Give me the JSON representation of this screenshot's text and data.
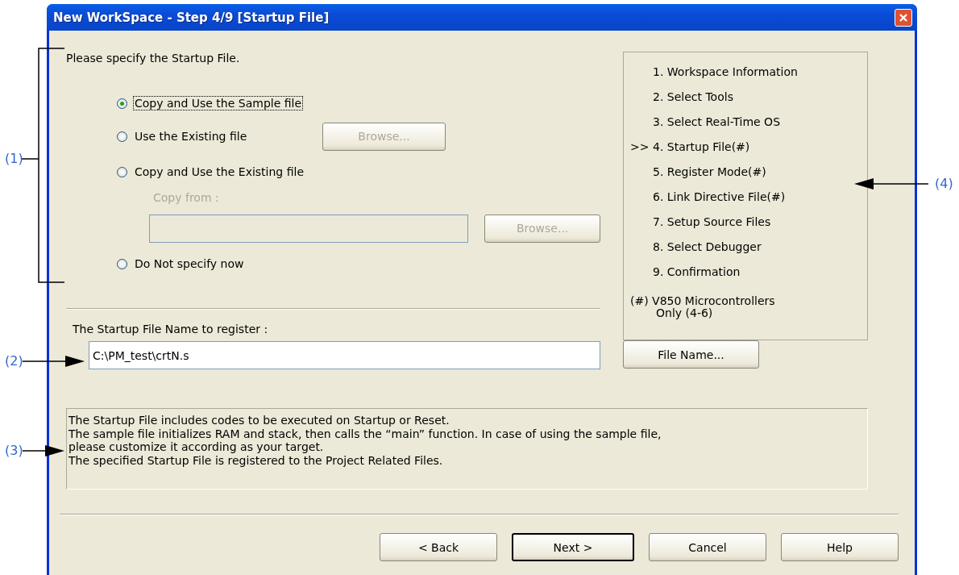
{
  "window": {
    "title": "New WorkSpace - Step 4/9 [Startup File]"
  },
  "prompt": "Please specify the Startup File.",
  "options": [
    {
      "label": "Copy and Use the Sample file",
      "selected": true,
      "focused": true
    },
    {
      "label": "Use the Existing file",
      "selected": false,
      "focused": false,
      "browse": {
        "label": "Browse...",
        "disabled": true
      }
    },
    {
      "label": "Copy and Use the Existing file",
      "selected": false,
      "focused": false,
      "copy_from": {
        "label": "Copy from :",
        "disabled": true
      },
      "browse": {
        "label": "Browse...",
        "disabled": true
      }
    },
    {
      "label": "Do Not specify now",
      "selected": false,
      "focused": false
    }
  ],
  "file_name_label": "The Startup File Name to register :",
  "file_name_value": "C:\\PM_test\\crtN.s",
  "file_name_button": {
    "label": "File Name..."
  },
  "steps": {
    "current_marker": ">>",
    "items": [
      {
        "label": "1. Workspace Information",
        "selected": false
      },
      {
        "label": "2. Select Tools",
        "selected": false
      },
      {
        "label": "3. Select Real-Time OS",
        "selected": false
      },
      {
        "label": "4. Startup File(#)",
        "selected": true
      },
      {
        "label": "5. Register Mode(#)",
        "selected": false
      },
      {
        "label": "6. Link Directive File(#)",
        "selected": false
      },
      {
        "label": "7. Setup Source Files",
        "selected": false
      },
      {
        "label": "8. Select Debugger",
        "selected": false
      },
      {
        "label": "9. Confirmation",
        "selected": false
      }
    ],
    "footnote": [
      "(#) V850 Microcontrollers",
      "Only (4-6)"
    ]
  },
  "description": [
    "The Startup File includes codes to be executed on Startup or Reset.",
    "The sample file initializes RAM and stack, then calls the “main” function. In case of using the sample file,",
    "please customize it according as your target.",
    "The specified Startup File is registered to the Project Related Files."
  ],
  "buttons": [
    {
      "label": "< Back",
      "default": false
    },
    {
      "label": "Next >",
      "default": true
    },
    {
      "label": "Cancel",
      "default": false
    },
    {
      "label": "Help",
      "default": false
    }
  ],
  "callouts": [
    {
      "label": "(1)",
      "kind": "bracket"
    },
    {
      "label": "(2)",
      "kind": "arrow"
    },
    {
      "label": "(3)",
      "kind": "arrow"
    },
    {
      "label": "(4)",
      "kind": "arrow"
    }
  ]
}
